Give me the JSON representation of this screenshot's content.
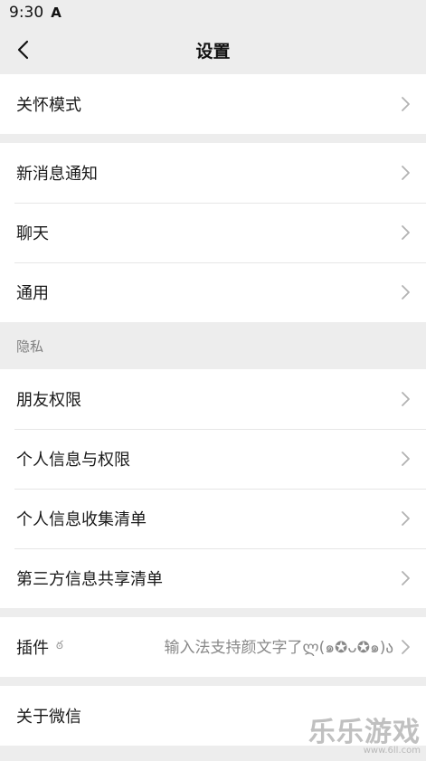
{
  "status": {
    "time": "9:30",
    "icon": "a-notification-icon"
  },
  "nav": {
    "title": "设置",
    "back_icon": "chevron-left-icon"
  },
  "group1": [
    {
      "label": "关怀模式"
    }
  ],
  "group2": [
    {
      "label": "新消息通知"
    },
    {
      "label": "聊天"
    },
    {
      "label": "通用"
    }
  ],
  "privacy": {
    "header": "隐私",
    "items": [
      {
        "label": "朋友权限"
      },
      {
        "label": "个人信息与权限"
      },
      {
        "label": "个人信息收集清单"
      },
      {
        "label": "第三方信息共享清单"
      }
    ]
  },
  "plugins": {
    "label": "插件",
    "badge": "ఠ",
    "value": "输入法支持颜文字了ლ(๑✪ᴗ✪๑)ა"
  },
  "about": {
    "label": "关于微信"
  },
  "watermark": {
    "title": "乐乐游戏",
    "url": "www.6ll.com"
  },
  "colors": {
    "background": "#ededed",
    "card": "#ffffff",
    "text": "#191919",
    "secondary": "#888888"
  }
}
